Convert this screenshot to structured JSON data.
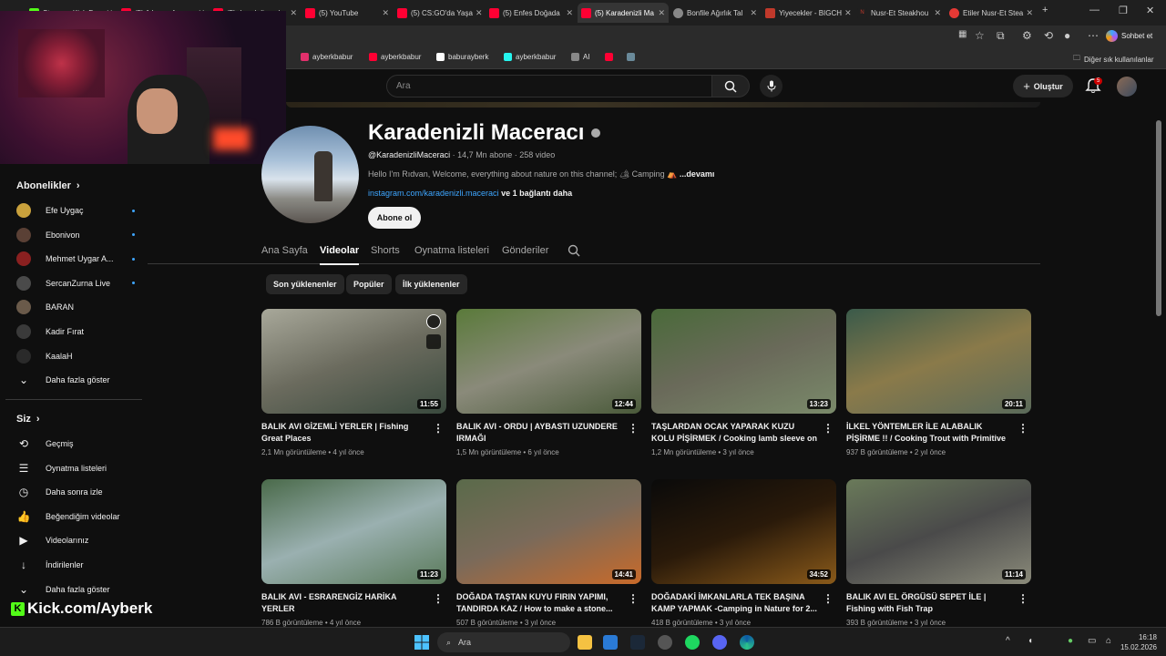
{
  "browser": {
    "tabs": [
      {
        "label": "Stream - Kick De",
        "icon": "kick-icon",
        "active": false
      },
      {
        "label": "(5) 1 hour of mov",
        "icon": "youtube-icon",
        "active": false
      },
      {
        "label": "(5) dread dione l",
        "icon": "youtube-icon",
        "active": false
      },
      {
        "label": "(5) YouTube",
        "icon": "youtube-icon",
        "active": false
      },
      {
        "label": "(5) CS:GO'da Yaşa",
        "icon": "youtube-icon",
        "active": false
      },
      {
        "label": "(5) Enfes Doğada",
        "icon": "youtube-icon",
        "active": false
      },
      {
        "label": "(5) Karadenizli Ma",
        "icon": "youtube-icon",
        "active": true
      },
      {
        "label": "Bonfile Ağırlık Tal",
        "icon": "globe-icon",
        "active": false
      },
      {
        "label": "Yiyecekler - BIGCH",
        "icon": "store-icon",
        "active": false
      },
      {
        "label": "Nusr-Et Steakhou",
        "icon": "nusret-icon",
        "active": false
      },
      {
        "label": "Etiler Nusr-Et Stea",
        "icon": "pin-icon",
        "active": false
      }
    ],
    "new_tab": "+",
    "chat_label": "Sohbet et",
    "bookmarks": [
      {
        "label": "ayberkbabur",
        "icon": "instagram-icon",
        "color": "#e1306c"
      },
      {
        "label": "ayberkbabur",
        "icon": "youtube-icon",
        "color": "#ff0033"
      },
      {
        "label": "baburayberk",
        "icon": "x-icon",
        "color": "#ffffff"
      },
      {
        "label": "ayberkbabur",
        "icon": "tiktok-icon",
        "color": "#25f4ee"
      },
      {
        "label": "AI",
        "icon": "ai-icon",
        "color": "#888888"
      }
    ],
    "other_bookmarks": "Diğer sık kullanılanlar"
  },
  "youtube": {
    "search_placeholder": "Ara",
    "create_label": "Oluştur",
    "notif_count": "5"
  },
  "sidebar": {
    "subs_title": "Abonelikler",
    "subs": [
      {
        "name": "Efe Uygaç",
        "color": "#c9a13c",
        "dot": true
      },
      {
        "name": "Ebonivon",
        "color": "#5a4035",
        "dot": true
      },
      {
        "name": "Mehmet Uygar A...",
        "color": "#8a2020",
        "dot": true
      },
      {
        "name": "SercanZurna Live",
        "color": "#4a4a4a",
        "dot": true
      },
      {
        "name": "BARAN",
        "color": "#6a5a4a",
        "dot": false
      },
      {
        "name": "Kadir Fırat",
        "color": "#3a3a3a",
        "dot": false
      },
      {
        "name": "KaalaH",
        "color": "#2a2a2a",
        "dot": false
      }
    ],
    "show_more": "Daha fazla göster",
    "you_title": "Siz",
    "you_items": [
      {
        "label": "Geçmiş",
        "icon": "history-icon",
        "glyph": "⟲"
      },
      {
        "label": "Oynatma listeleri",
        "icon": "playlist-icon",
        "glyph": "☰"
      },
      {
        "label": "Daha sonra izle",
        "icon": "clock-icon",
        "glyph": "◷"
      },
      {
        "label": "Beğendiğim videolar",
        "icon": "like-icon",
        "glyph": "👍"
      },
      {
        "label": "Videolarınız",
        "icon": "video-icon",
        "glyph": "▶"
      },
      {
        "label": "İndirilenler",
        "icon": "download-icon",
        "glyph": "↓"
      }
    ],
    "show_more_2": "Daha fazla göster"
  },
  "overlay": {
    "kick_text": "Kick.com/Ayberk"
  },
  "channel": {
    "name": "Karadenizli Maceracı",
    "handle": "@KaradenizliMaceraci",
    "subscribers": "14,7 Mn abone",
    "video_count": "258 video",
    "description": "Hello I'm Rıdvan, Welcome, everything about nature on this channel; 🏕 Camping ⛺",
    "more": "...devamı",
    "link": "instagram.com/karadenizli.maceraci",
    "link_more": "ve 1 bağlantı daha",
    "subscribe": "Abone ol",
    "tabs": [
      "Ana Sayfa",
      "Videolar",
      "Shorts",
      "Oynatma listeleri",
      "Gönderiler"
    ],
    "active_tab": "Videolar",
    "chips": [
      "Son yüklenenler",
      "Popüler",
      "İlk yüklenenler"
    ]
  },
  "videos": [
    {
      "title": "BALIK AVI GİZEMLİ YERLER | Fishing Great Places",
      "views": "2,1 Mn görüntüleme",
      "age": "4 yıl önce",
      "duration": "11:55",
      "colors": [
        "#a8a89a",
        "#6b6b5e",
        "#3a4a3e"
      ]
    },
    {
      "title": "BALIK AVI - ORDU | AYBASTI UZUNDERE IRMAĞI",
      "views": "1,5 Mn görüntüleme",
      "age": "6 yıl önce",
      "duration": "12:44",
      "colors": [
        "#5a7a3a",
        "#8a8a7a",
        "#4a5a3a"
      ]
    },
    {
      "title": "TAŞLARDAN OCAK YAPARAK KUZU KOLU PİŞİRMEK / Cooking lamb sleeve on stone...",
      "views": "1,2 Mn görüntüleme",
      "age": "3 yıl önce",
      "duration": "13:23",
      "colors": [
        "#4a6a3a",
        "#6a6a5a",
        "#7a8a6a"
      ]
    },
    {
      "title": "İLKEL YÖNTEMLER İLE ALABALIK PİŞİRME !! / Cooking Trout with Primitive methods",
      "views": "937 B görüntüleme",
      "age": "2 yıl önce",
      "duration": "20:11",
      "colors": [
        "#3a5a4a",
        "#8a7a4a",
        "#5a6a5a"
      ]
    },
    {
      "title": "BALIK AVI - ESRARENGİZ HARİKA YERLER",
      "views": "786 B görüntüleme",
      "age": "4 yıl önce",
      "duration": "11:23",
      "colors": [
        "#4a6a4a",
        "#9ab0b0",
        "#5a7a5a"
      ]
    },
    {
      "title": "DOĞADA TAŞTAN KUYU FIRIN YAPIMI, TANDIRDA KAZ / How to make a stone...",
      "views": "507 B görüntüleme",
      "age": "3 yıl önce",
      "duration": "14:41",
      "colors": [
        "#5a6a4a",
        "#7a6a5a",
        "#c86a2a"
      ]
    },
    {
      "title": "DOĞADAKİ İMKANLARLA TEK BAŞINA KAMP YAPMAK -Camping in Nature for 2...",
      "views": "418 B görüntüleme",
      "age": "3 yıl önce",
      "duration": "34:52",
      "colors": [
        "#0a0a0a",
        "#2a1a0a",
        "#8a5a1a"
      ]
    },
    {
      "title": "BALIK AVI EL ÖRGÜSÜ SEPET İLE | Fishing with Fish Trap",
      "views": "393 B görüntüleme",
      "age": "3 yıl önce",
      "duration": "11:14",
      "colors": [
        "#6a7a5a",
        "#4a4a4a",
        "#8a8a7a"
      ]
    }
  ],
  "taskbar": {
    "search": "Ara",
    "time": "16:18",
    "date": "15.02.2026"
  }
}
